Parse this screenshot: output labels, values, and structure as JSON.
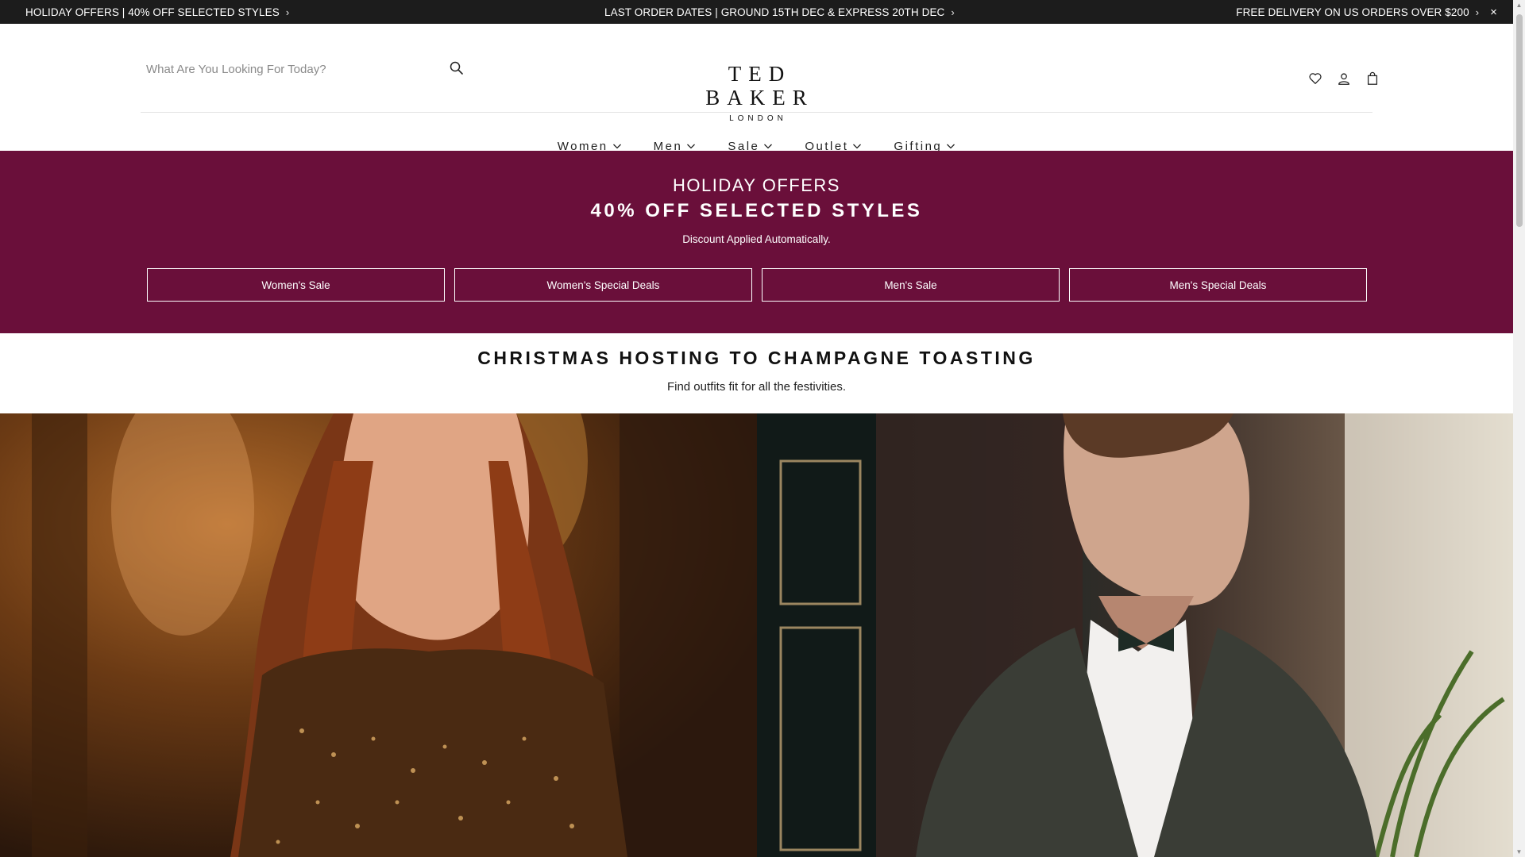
{
  "topbar": {
    "promo_left": "HOLIDAY OFFERS | 40% OFF SELECTED STYLES",
    "promo_center": "LAST ORDER DATES | GROUND 15TH DEC & EXPRESS 20TH DEC",
    "promo_right": "FREE DELIVERY ON US ORDERS OVER $200",
    "chevron": "›",
    "close": "×"
  },
  "header": {
    "search_placeholder": "What Are You Looking For Today?",
    "logo_main": "TED BAKER",
    "logo_sub": "LONDON",
    "icons": [
      "heart-icon",
      "user-icon",
      "bag-icon"
    ]
  },
  "nav": {
    "items": [
      {
        "label": "Women"
      },
      {
        "label": "Men"
      },
      {
        "label": "Sale"
      },
      {
        "label": "Outlet"
      },
      {
        "label": "Gifting"
      }
    ]
  },
  "banner": {
    "heading": "HOLIDAY OFFERS",
    "subheading": "40% OFF SELECTED STYLES",
    "note": "Discount Applied Automatically.",
    "background": "#6a0f3a",
    "buttons": [
      {
        "label": "Women's Sale"
      },
      {
        "label": "Women's Special Deals"
      },
      {
        "label": "Men's Sale"
      },
      {
        "label": "Men's Special Deals"
      }
    ]
  },
  "feature": {
    "title": "CHRISTMAS HOSTING TO CHAMPAGNE TOASTING",
    "subtitle": "Find outfits fit for all the festivities."
  },
  "tiles": [
    {
      "subject": "woman-sequin-top-photo"
    },
    {
      "subject": "man-tuxedo-bowtie-photo"
    }
  ]
}
